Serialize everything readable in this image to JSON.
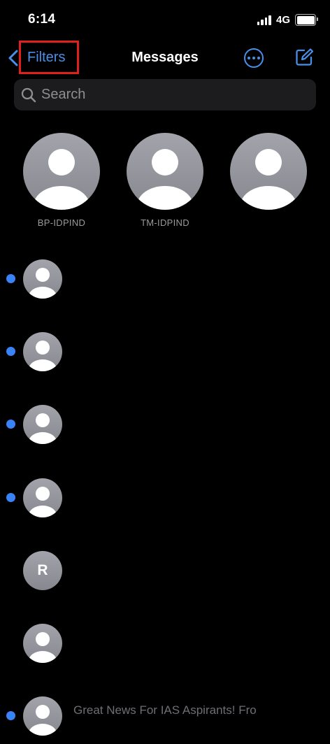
{
  "status_bar": {
    "time": "6:14",
    "network": "4G",
    "signal_icon": "signal-bars-icon",
    "battery_icon": "battery-icon"
  },
  "nav": {
    "back_label": "Filters",
    "title": "Messages",
    "back_icon": "chevron-left-icon",
    "more_icon": "ellipsis-circle-icon",
    "compose_icon": "compose-icon"
  },
  "search": {
    "placeholder": "Search",
    "icon": "magnifier-icon"
  },
  "pinned": [
    {
      "label": "BP-IDPIND"
    },
    {
      "label": "TM-IDPIND"
    },
    {
      "label": ""
    }
  ],
  "conversations": [
    {
      "avatar": "person-icon",
      "unread": true,
      "preview": ""
    },
    {
      "avatar": "person-icon",
      "unread": true,
      "preview": ""
    },
    {
      "avatar": "person-icon",
      "unread": true,
      "preview": ""
    },
    {
      "avatar": "person-icon",
      "unread": true,
      "preview": ""
    },
    {
      "avatar_initial": "R",
      "unread": false,
      "preview": ""
    },
    {
      "avatar": "person-icon",
      "unread": false,
      "preview": ""
    },
    {
      "avatar": "person-icon",
      "unread": true,
      "preview": "Great News For IAS Aspirants! Fro"
    }
  ],
  "colors": {
    "accent": "#4a8fe8",
    "unread_dot": "#3a82f7",
    "highlight_box": "#e0201c",
    "background": "#000000"
  }
}
